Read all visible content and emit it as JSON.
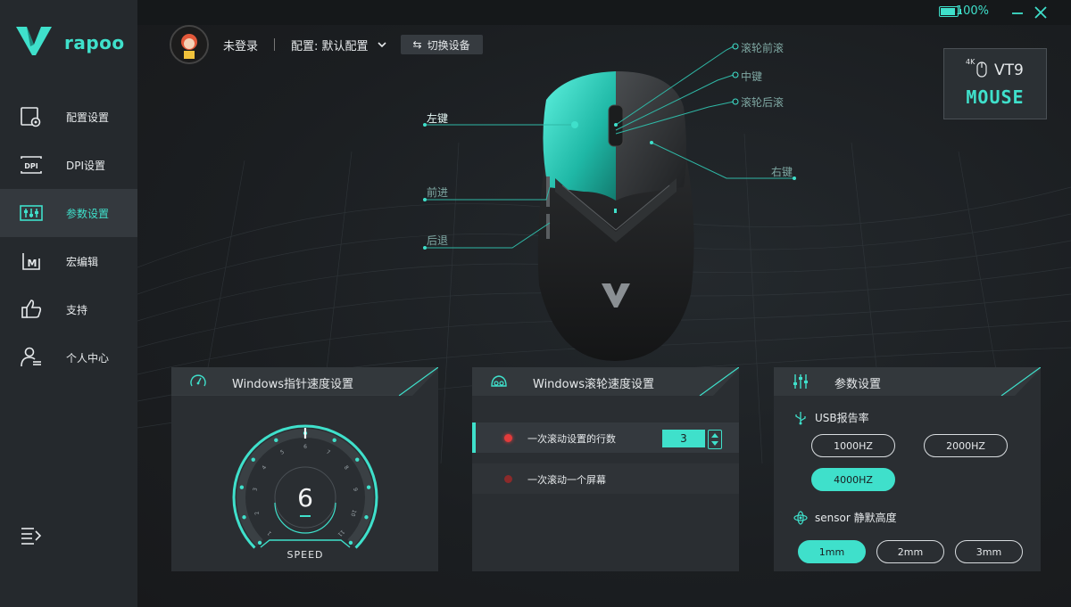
{
  "app": {
    "brand": "rapoo"
  },
  "titlebar": {
    "battery_text": "100%",
    "battery_level": 1.0
  },
  "sidebar": {
    "items": [
      {
        "label": "配置设置",
        "icon": "config-icon"
      },
      {
        "label": "DPI设置",
        "icon": "dpi-icon"
      },
      {
        "label": "参数设置",
        "icon": "params-icon",
        "active": true
      },
      {
        "label": "宏编辑",
        "icon": "macro-icon"
      },
      {
        "label": "支持",
        "icon": "thumbs-up-icon"
      },
      {
        "label": "个人中心",
        "icon": "user-icon"
      }
    ]
  },
  "header": {
    "user_name": "未登录",
    "config_label": "配置: 默认配置",
    "switch_device": "切换设备"
  },
  "mouse": {
    "labels": {
      "scroll_forward": "滚轮前滚",
      "middle": "中键",
      "scroll_back": "滚轮后滚",
      "left": "左键",
      "right": "右键",
      "forward": "前进",
      "back": "后退"
    }
  },
  "device_badge": {
    "mark": "4K",
    "model": "VT9",
    "word": "MOUSE"
  },
  "pointer_panel": {
    "title": "Windows指针速度设置",
    "value": "6",
    "label": "SPEED",
    "ticks": [
      "1",
      "2",
      "3",
      "4",
      "5",
      "6",
      "7",
      "8",
      "9",
      "10",
      "11"
    ]
  },
  "scroll_panel": {
    "title": "Windows滚轮速度设置",
    "option_lines": "一次滚动设置的行数",
    "lines_value": "3",
    "option_screen": "一次滚动一个屏幕"
  },
  "param_panel": {
    "title": "参数设置",
    "usb_label": "USB报告率",
    "rates": [
      "1000HZ",
      "2000HZ",
      "4000HZ"
    ],
    "selected_rate": "4000HZ",
    "lod_label": "sensor 静默高度",
    "heights": [
      "1mm",
      "2mm",
      "3mm"
    ],
    "selected_height": "1mm"
  },
  "colors": {
    "accent": "#3fe0cb",
    "bg": "#1a1d20",
    "panel": "#2a2e32",
    "sidebar": "#25292d"
  }
}
